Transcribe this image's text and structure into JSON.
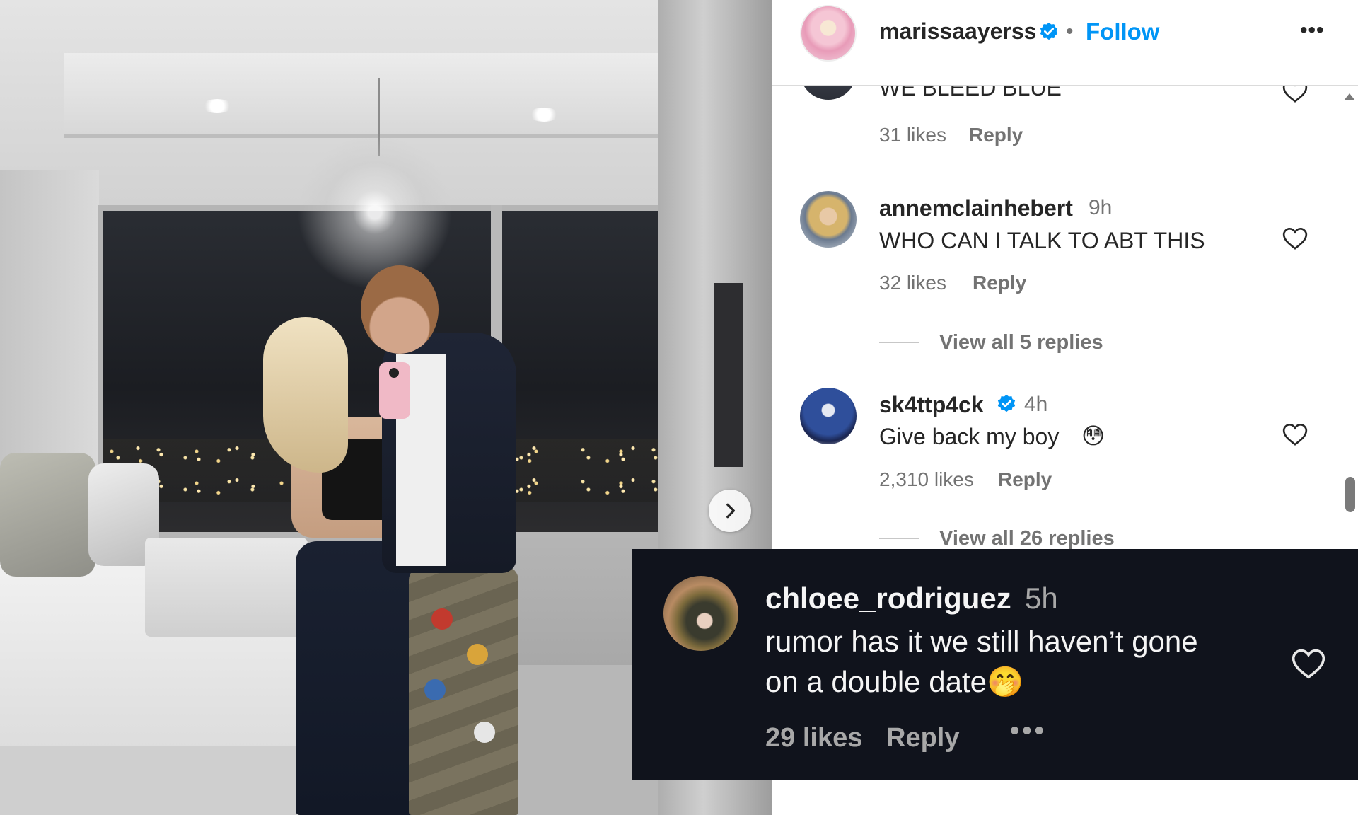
{
  "post": {
    "author": "marissaayerss",
    "follow_label": "Follow",
    "dot": "•",
    "more_label": "•••",
    "next_icon": "chevron-right-icon"
  },
  "comments": [
    {
      "text": "WE BLEED BLUE",
      "likes": "31 likes",
      "reply": "Reply"
    },
    {
      "user": "annemclainhebert",
      "time": "9h",
      "text": "WHO CAN I TALK TO ABT THIS",
      "likes": "32 likes",
      "reply": "Reply",
      "view_replies": "View all 5 replies"
    },
    {
      "user": "sk4ttp4ck",
      "verified": true,
      "time": "4h",
      "text": "Give back my boy",
      "emoji": "😳",
      "likes": "2,310 likes",
      "reply": "Reply",
      "view_replies": "View all 26 replies"
    }
  ],
  "highlight": {
    "user": "chloee_rodriguez",
    "time": "5h",
    "text_line1": "rumor has it we still haven’t gone",
    "text_line2": "on a double date",
    "emoji": "🤭",
    "likes": "29 likes",
    "reply": "Reply",
    "more": "•••"
  },
  "colors": {
    "link_blue": "#0095f6",
    "verified_blue": "#0095f6",
    "overlay_bg": "#10131c",
    "muted_text": "#737373"
  }
}
